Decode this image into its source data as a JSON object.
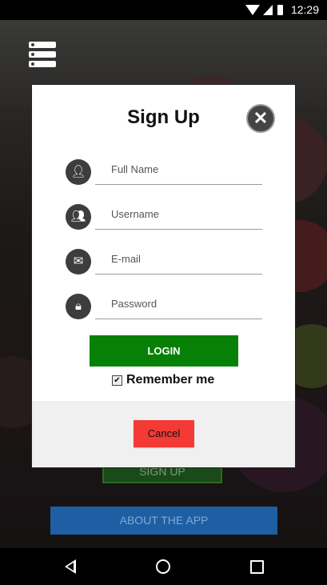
{
  "status_bar": {
    "time": "12:29"
  },
  "background": {
    "signup_button_label": "SIGN UP",
    "about_button_label": "ABOUT THE APP"
  },
  "modal": {
    "title": "Sign Up",
    "fields": [
      {
        "icon": "user-icon",
        "placeholder": "Full Name"
      },
      {
        "icon": "users-icon",
        "placeholder": "Username"
      },
      {
        "icon": "envelope-icon",
        "placeholder": "E-mail"
      },
      {
        "icon": "lock-icon",
        "placeholder": "Password"
      }
    ],
    "login_label": "LOGIN",
    "remember_label": "Remember me",
    "remember_checked": true,
    "cancel_label": "Cancel"
  },
  "colors": {
    "login_green": "#078007",
    "cancel_red": "#f33a34",
    "about_blue": "#1e5fa3"
  }
}
